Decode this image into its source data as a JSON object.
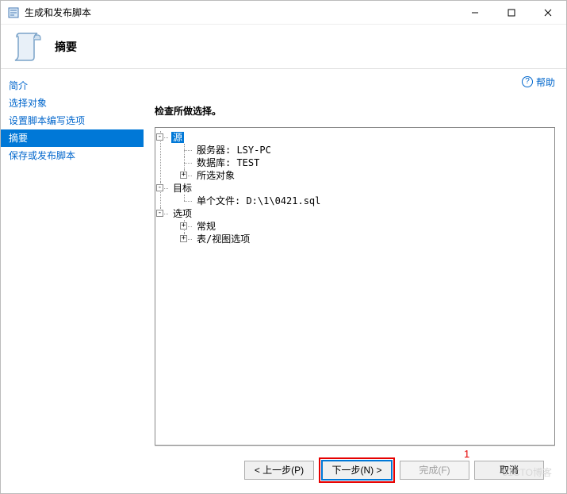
{
  "window": {
    "title": "生成和发布脚本",
    "min": "—",
    "max": "☐",
    "close": "✕"
  },
  "header": {
    "title": "摘要"
  },
  "sidebar": {
    "items": [
      {
        "label": "简介",
        "active": false
      },
      {
        "label": "选择对象",
        "active": false
      },
      {
        "label": "设置脚本编写选项",
        "active": false
      },
      {
        "label": "摘要",
        "active": true
      },
      {
        "label": "保存或发布脚本",
        "active": false
      }
    ]
  },
  "content": {
    "help_label": "帮助",
    "instruction": "检查所做选择。"
  },
  "tree": {
    "root": [
      {
        "label": "源",
        "selected": true,
        "expanded": true,
        "children": [
          {
            "label": "服务器: LSY-PC"
          },
          {
            "label": "数据库: TEST"
          },
          {
            "label": "所选对象",
            "expandable": true,
            "expanded": false
          }
        ]
      },
      {
        "label": "目标",
        "expanded": true,
        "children": [
          {
            "label": "单个文件: D:\\1\\0421.sql"
          }
        ]
      },
      {
        "label": "选项",
        "expanded": true,
        "children": [
          {
            "label": "常规",
            "expandable": true,
            "expanded": false
          },
          {
            "label": "表/视图选项",
            "expandable": true,
            "expanded": false
          }
        ]
      }
    ]
  },
  "footer": {
    "annotation": "1",
    "prev": "< 上一步(P)",
    "next": "下一步(N) >",
    "finish": "完成(F)",
    "cancel": "取消"
  },
  "watermark": "51CTO博客"
}
